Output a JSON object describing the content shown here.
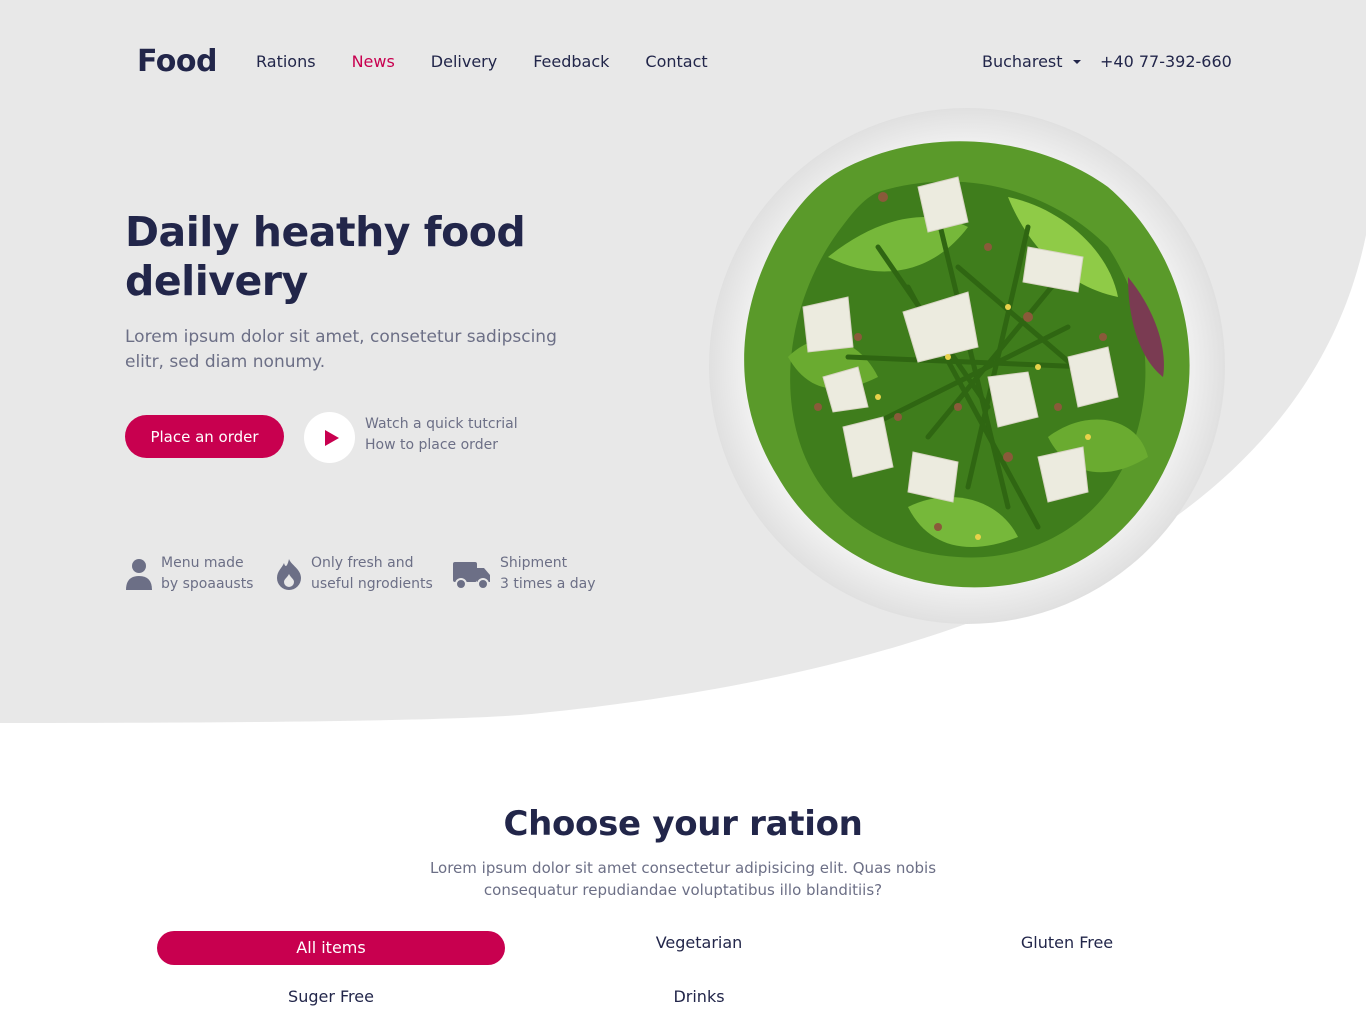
{
  "brand": {
    "logo": "Food"
  },
  "nav": {
    "items": [
      {
        "label": "Rations",
        "active": false
      },
      {
        "label": "News",
        "active": true
      },
      {
        "label": "Delivery",
        "active": false
      },
      {
        "label": "Feedback",
        "active": false
      },
      {
        "label": "Contact",
        "active": false
      }
    ]
  },
  "header": {
    "city": "Bucharest",
    "phone": "+40 77-392-660"
  },
  "hero": {
    "title": "Daily heathy food delivery",
    "subtitle": "Lorem ipsum dolor sit amet, consetetur sadipscing elitr, sed diam nonumy.",
    "order_button": "Place an order",
    "watch_line1": "Watch a quick tutcrial",
    "watch_line2": "How to place order"
  },
  "features": [
    {
      "icon": "user-icon",
      "line1": "Menu made",
      "line2": "by spoaausts"
    },
    {
      "icon": "fire-icon",
      "line1": "Only fresh and",
      "line2": "useful ngrodients"
    },
    {
      "icon": "truck-icon",
      "line1": "Shipment",
      "line2": "3 times a day"
    }
  ],
  "rations": {
    "title": "Choose your ration",
    "subtitle": "Lorem ipsum dolor sit amet consectetur adipisicing elit. Quas nobis consequatur repudiandae voluptatibus illo blanditiis?",
    "tabs": [
      {
        "label": "All items",
        "active": true
      },
      {
        "label": "Vegetarian",
        "active": false
      },
      {
        "label": "Gluten Free",
        "active": false
      },
      {
        "label": "Suger Free",
        "active": false
      },
      {
        "label": "Drinks",
        "active": false
      }
    ]
  },
  "colors": {
    "accent": "#c8004f",
    "hero_bg": "#e8e8e8",
    "text_dark": "#22264a",
    "text_muted": "#6c6f86"
  }
}
